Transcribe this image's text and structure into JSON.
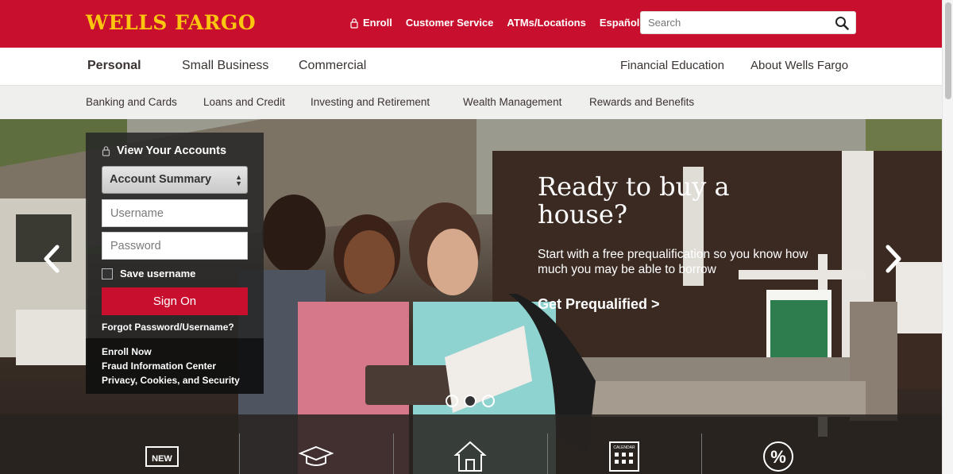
{
  "brand": {
    "logo_text": "WELLS FARGO",
    "primary_color": "#c8102e",
    "logo_color": "#fcc60e"
  },
  "top_links": {
    "enroll": "Enroll",
    "customer_service": "Customer Service",
    "atms": "ATMs/Locations",
    "espanol": "Español"
  },
  "search": {
    "placeholder": "Search"
  },
  "main_nav": {
    "personal": "Personal",
    "small_business": "Small Business",
    "commercial": "Commercial",
    "financial_education": "Financial Education",
    "about": "About Wells Fargo"
  },
  "sub_nav": {
    "banking": "Banking and Cards",
    "loans": "Loans and Credit",
    "investing": "Investing and Retirement",
    "wealth": "Wealth Management",
    "rewards": "Rewards and Benefits"
  },
  "signon": {
    "heading": "View Your Accounts",
    "account_select": "Account Summary",
    "username_placeholder": "Username",
    "password_placeholder": "Password",
    "save_username": "Save username",
    "button": "Sign On",
    "forgot": "Forgot Password/Username?",
    "links": {
      "enroll": "Enroll Now",
      "fraud": "Fraud Information Center",
      "privacy": "Privacy, Cookies, and Security"
    }
  },
  "hero": {
    "title": "Ready to buy a house?",
    "text": "Start with a free prequalification so you know how much you may be able to borrow",
    "cta": "Get Prequalified >",
    "slides": 3,
    "active_slide": 1
  },
  "features": {
    "icons": [
      "new-badge-icon",
      "graduation-cap-icon",
      "house-icon",
      "calendar-icon",
      "percent-icon"
    ],
    "new_badge_text": "NEW",
    "calendar_text": "CALENDAR"
  }
}
